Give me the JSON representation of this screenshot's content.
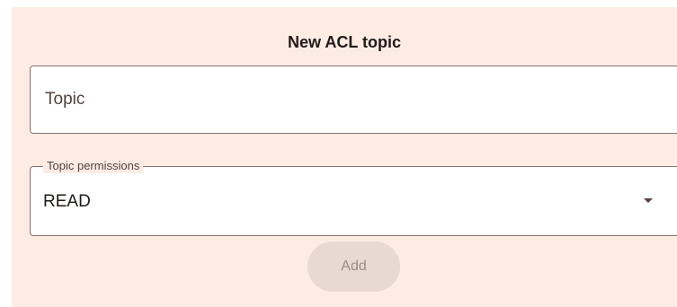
{
  "form": {
    "title": "New ACL topic",
    "topic": {
      "value": "",
      "placeholder": "Topic"
    },
    "permissions": {
      "label": "Topic permissions",
      "selected": "READ",
      "icon": "arrow-drop-down-icon"
    },
    "add_button_label": "Add"
  },
  "colors": {
    "panel_background": "#fcece4",
    "field_background": "#ffffff",
    "outline": "#85736d",
    "disabled_button": "#e8d9d2"
  }
}
